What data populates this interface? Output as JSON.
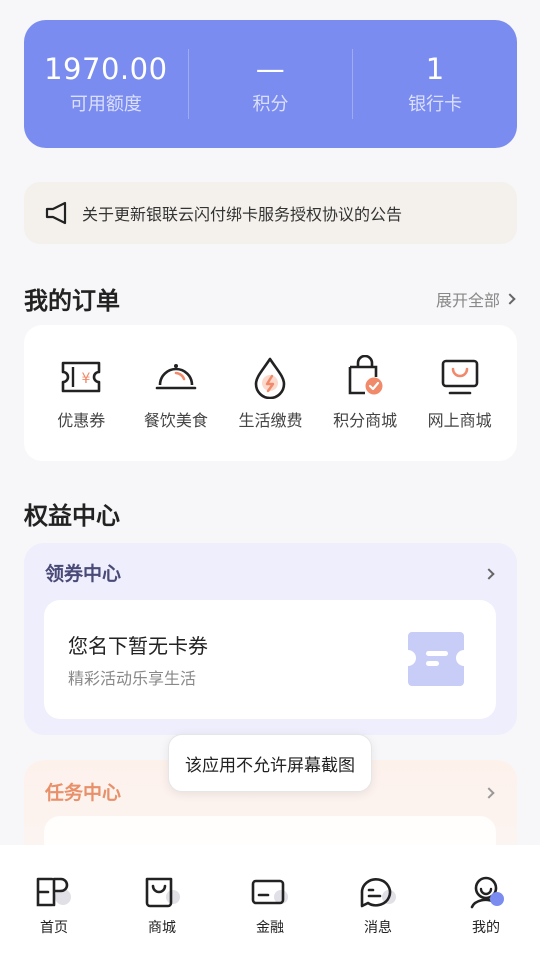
{
  "stats": [
    {
      "value": "1970.00",
      "label": "可用额度"
    },
    {
      "value": "—",
      "label": "积分"
    },
    {
      "value": "1",
      "label": "银行卡"
    }
  ],
  "notice": {
    "icon": "megaphone-icon",
    "text": "关于更新银联云闪付绑卡服务授权协议的公告"
  },
  "orders": {
    "title": "我的订单",
    "expand_label": "展开全部",
    "items": [
      {
        "label": "优惠券",
        "icon": "coupon-icon"
      },
      {
        "label": "餐饮美食",
        "icon": "dish-cloche-icon"
      },
      {
        "label": "生活缴费",
        "icon": "utility-drop-icon"
      },
      {
        "label": "积分商城",
        "icon": "points-bag-icon"
      },
      {
        "label": "网上商城",
        "icon": "online-mall-icon"
      }
    ]
  },
  "rights": {
    "title": "权益中心",
    "coupon_center": {
      "title": "领券中心",
      "main_text": "您名下暂无卡券",
      "sub_text": "精彩活动乐享生活"
    },
    "task_center": {
      "title": "任务中心"
    }
  },
  "toast": {
    "text": "该应用不允许屏幕截图"
  },
  "nav": [
    {
      "label": "首页",
      "icon": "home-icon"
    },
    {
      "label": "商城",
      "icon": "mall-icon"
    },
    {
      "label": "金融",
      "icon": "card-icon"
    },
    {
      "label": "消息",
      "icon": "message-icon"
    },
    {
      "label": "我的",
      "icon": "profile-icon"
    }
  ],
  "colors": {
    "accent": "#7b8cf0",
    "task_accent": "#e8906a",
    "order_icon_accent": "#f08a6a"
  }
}
